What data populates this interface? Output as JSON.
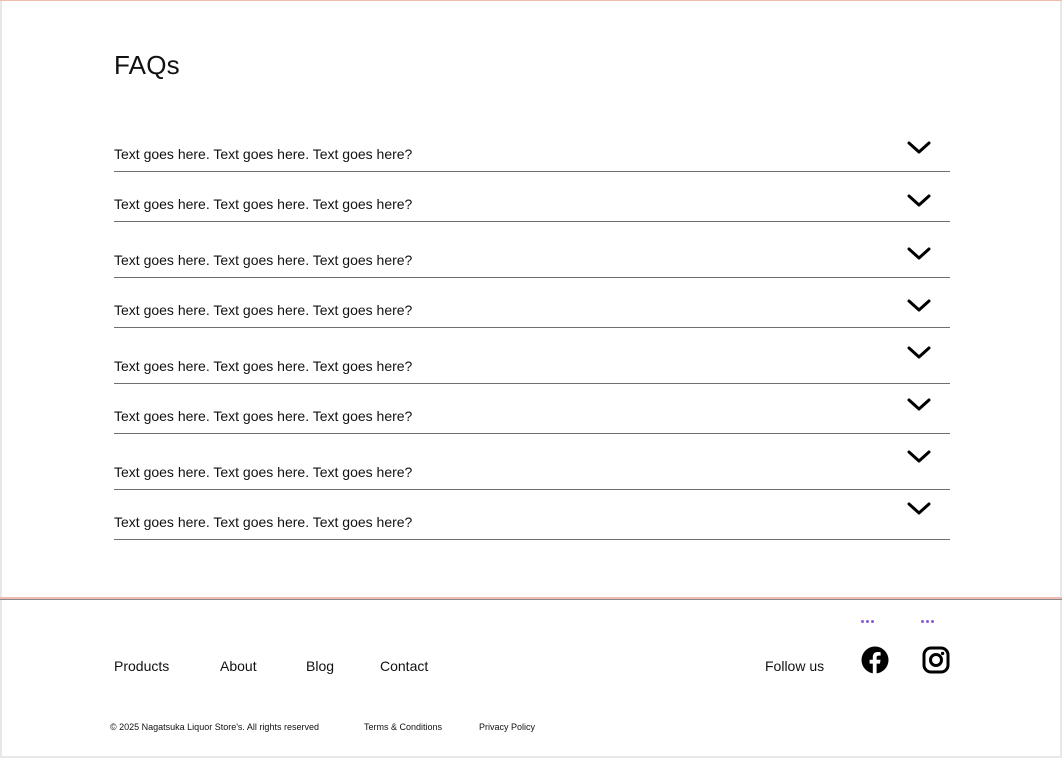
{
  "faq": {
    "title": "FAQs",
    "items": [
      {
        "question": "Text goes here. Text goes here. Text goes here?"
      },
      {
        "question": "Text goes here. Text goes here. Text goes here?"
      },
      {
        "question": "Text goes here. Text goes here. Text goes here?"
      },
      {
        "question": "Text goes here. Text goes here. Text goes here?"
      },
      {
        "question": "Text goes here. Text goes here. Text goes here?"
      },
      {
        "question": "Text goes here. Text goes here. Text goes here?"
      },
      {
        "question": "Text goes here. Text goes here. Text goes here?"
      },
      {
        "question": "Text goes here. Text goes here. Text goes here?"
      }
    ],
    "expand_icon": "chevron-down-icon"
  },
  "footer": {
    "nav": [
      {
        "label": "Products"
      },
      {
        "label": "About"
      },
      {
        "label": "Blog"
      },
      {
        "label": "Contact"
      }
    ],
    "follow_label": "Follow us",
    "social": [
      {
        "icon": "facebook-icon"
      },
      {
        "icon": "instagram-icon"
      }
    ],
    "copyright": "© 2025 Nagatsuka Liquor Store's. All rights reserved",
    "terms": "Terms & Conditions",
    "privacy": "Privacy Policy"
  },
  "colors": {
    "accent_rule": "#f2b9b0",
    "dots": "#8a5bd6",
    "text": "#111111"
  }
}
